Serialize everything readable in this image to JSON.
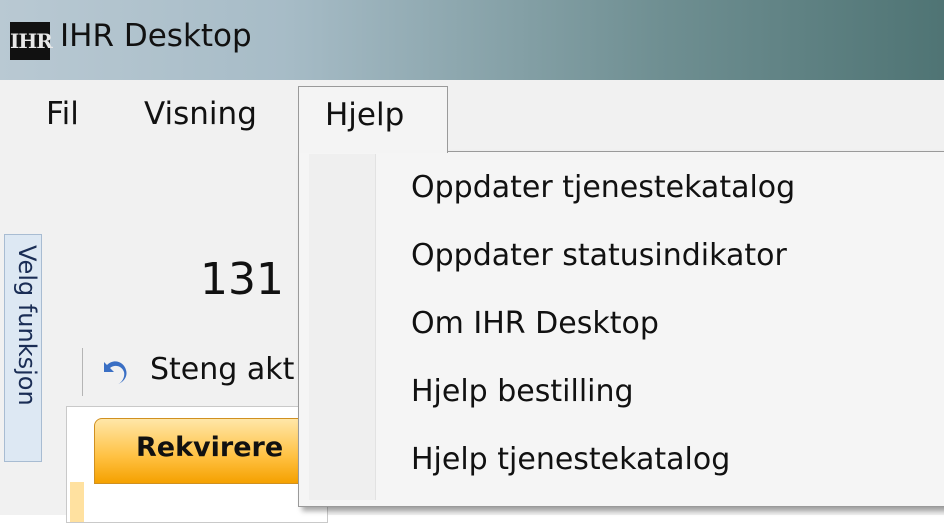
{
  "window": {
    "title": "IHR Desktop",
    "icon_text": "IHR"
  },
  "menubar": {
    "items": [
      {
        "label": "Fil"
      },
      {
        "label": "Visning"
      },
      {
        "label": "Hjelp"
      }
    ]
  },
  "dropdown": {
    "items": [
      {
        "label": "Oppdater tjenestekatalog"
      },
      {
        "label": "Oppdater statusindikator"
      },
      {
        "label": "Om IHR Desktop"
      },
      {
        "label": "Hjelp bestilling"
      },
      {
        "label": "Hjelp tjenestekatalog"
      }
    ]
  },
  "sidebar": {
    "tab_label": "Velg funksjon"
  },
  "main": {
    "number_text": "131",
    "toolbar_close_label": "Steng akt",
    "active_tab_label": "Rekvirere"
  },
  "colors": {
    "accent_tab": "#ffc040",
    "titlebar_end": "#4f7474"
  }
}
